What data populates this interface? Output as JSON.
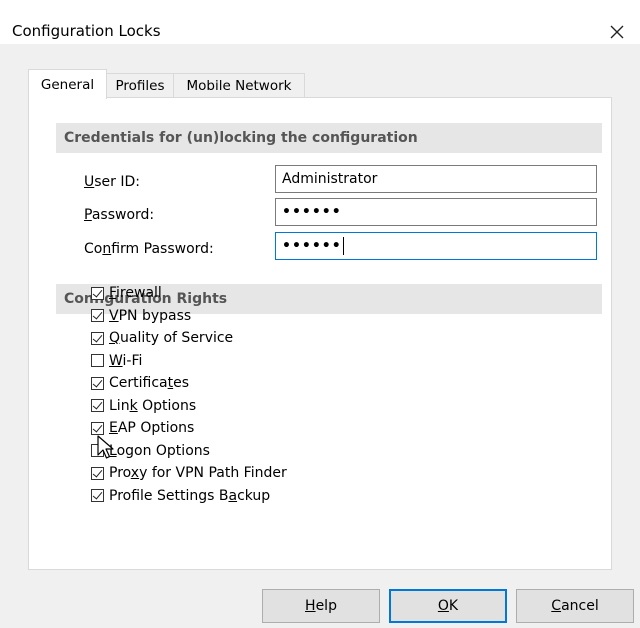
{
  "window": {
    "title": "Configuration Locks",
    "close_icon": "close-icon"
  },
  "tabs": [
    {
      "label": "General",
      "active": true
    },
    {
      "label": "Profiles",
      "active": false
    },
    {
      "label": "Mobile Network",
      "active": false
    }
  ],
  "credentials": {
    "header": "Credentials for (un)locking the configuration",
    "user_id_label": "User ID:",
    "user_id_value": "Administrator",
    "password_label": "Password:",
    "password_value": "••••••",
    "confirm_label": "Confirm Password:",
    "confirm_value": "••••••"
  },
  "rights": {
    "header": "Configuration Rights",
    "items": [
      {
        "label": "Firewall",
        "checked": true
      },
      {
        "label": "VPN bypass",
        "checked": true
      },
      {
        "label": "Quality of Service",
        "checked": true
      },
      {
        "label": "Wi-Fi",
        "checked": false
      },
      {
        "label": "Certificates",
        "checked": true
      },
      {
        "label": "Link Options",
        "checked": true
      },
      {
        "label": "EAP Options",
        "checked": true
      },
      {
        "label": "Logon Options",
        "checked": false
      },
      {
        "label": "Proxy for VPN Path Finder",
        "checked": true
      },
      {
        "label": "Profile Settings Backup",
        "checked": true
      }
    ]
  },
  "buttons": {
    "help": "Help",
    "ok": "OK",
    "cancel": "Cancel"
  },
  "colors": {
    "accent": "#0078d7",
    "section_header_bg": "#e6e6e6",
    "dialog_bg": "#f0f0f0"
  }
}
